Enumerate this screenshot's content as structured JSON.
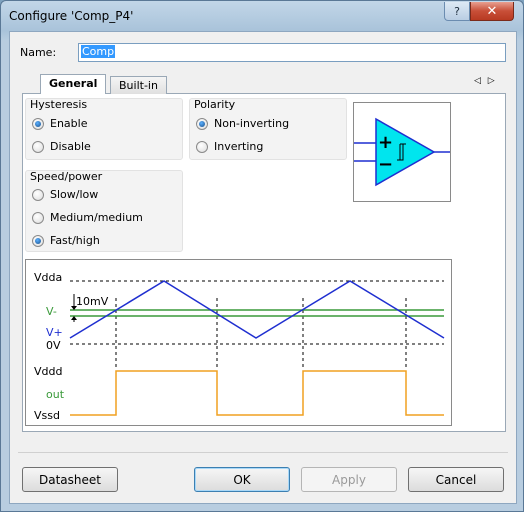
{
  "window": {
    "title": "Configure 'Comp_P4'",
    "help_label": "?",
    "close_label": "✕"
  },
  "name": {
    "label": "Name:",
    "value": "Comp"
  },
  "tabs": [
    {
      "label": "General"
    },
    {
      "label": "Built-in"
    }
  ],
  "tab_arrows": "◁ ▷",
  "hysteresis": {
    "title": "Hysteresis",
    "options": [
      "Enable",
      "Disable"
    ],
    "selected": "Enable"
  },
  "polarity": {
    "title": "Polarity",
    "options": [
      "Non-inverting",
      "Inverting"
    ],
    "selected": "Non-inverting"
  },
  "speed": {
    "title": "Speed/power",
    "options": [
      "Slow/low",
      "Medium/medium",
      "Fast/high"
    ],
    "selected": "Fast/high"
  },
  "symbol": {
    "plus": "+",
    "minus": "−",
    "fill_color": "#00e5ee"
  },
  "waveform": {
    "labels": {
      "vdda": "Vdda",
      "vminus": "V-",
      "vplus": "V+",
      "zero": "0V",
      "vddd": "Vddd",
      "out": "out",
      "vssd": "Vssd",
      "hyst": "10mV"
    },
    "colors": {
      "triangle": "#1f2fd0",
      "threshold": "#3a9a3a",
      "output": "#f0a020"
    }
  },
  "buttons": {
    "datasheet": "Datasheet",
    "ok": "OK",
    "apply": "Apply",
    "cancel": "Cancel"
  }
}
